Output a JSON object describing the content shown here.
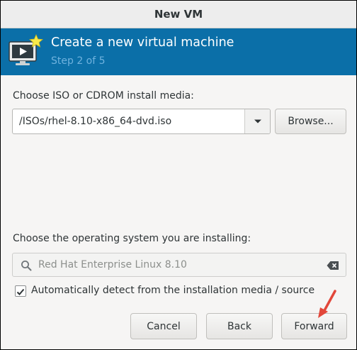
{
  "window": {
    "title": "New VM"
  },
  "banner": {
    "title": "Create a new virtual machine",
    "step": "Step 2 of 5",
    "icon": "monitor-play-icon",
    "background_color": "#0b6fa8"
  },
  "install_media": {
    "label": "Choose ISO or CDROM install media:",
    "value": "/ISOs/rhel-8.10-x86_64-dvd.iso",
    "browse_label": "Browse..."
  },
  "os_select": {
    "label": "Choose the operating system you are installing:",
    "value": "Red Hat Enterprise Linux 8.10"
  },
  "auto_detect": {
    "label": "Automatically detect from the installation media / source",
    "checked": true
  },
  "buttons": {
    "cancel": "Cancel",
    "back": "Back",
    "forward": "Forward"
  },
  "annotation": {
    "arrow_color": "#e2473a"
  }
}
